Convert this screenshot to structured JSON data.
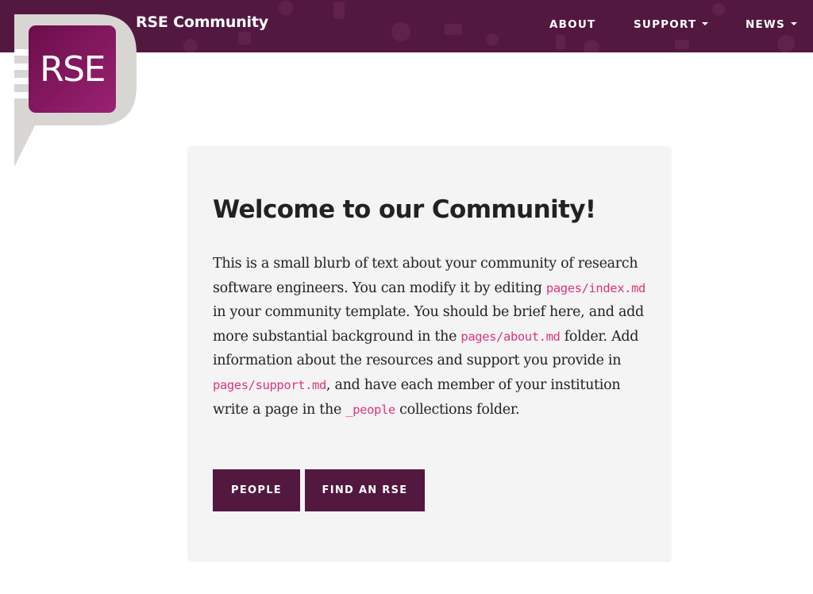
{
  "brand": {
    "logo_text": "RSE",
    "title": "RSE Community"
  },
  "nav": {
    "about": "ABOUT",
    "support": "SUPPORT",
    "news": "NEWS"
  },
  "hero": {
    "title": "Welcome to our Community!",
    "body": {
      "t1": "This is a small blurb of text about your community of research software engineers. You can modify it by editing ",
      "c1": "pages/index.md",
      "t2": " in your community template. You should be brief here, and add more substantial background in the ",
      "c2": "pages/about.md",
      "t3": " folder. Add information about the resources and support you provide in ",
      "c3": "pages/support.md",
      "t4": ", and have each member of your institution write a page in the ",
      "c4": "_people",
      "t5": " collections folder."
    },
    "buttons": {
      "people": "PEOPLE",
      "find_rse": "FIND AN RSE"
    }
  },
  "colors": {
    "brand": "#531840",
    "code": "#e0347c",
    "card_bg": "#f4f4f4"
  }
}
